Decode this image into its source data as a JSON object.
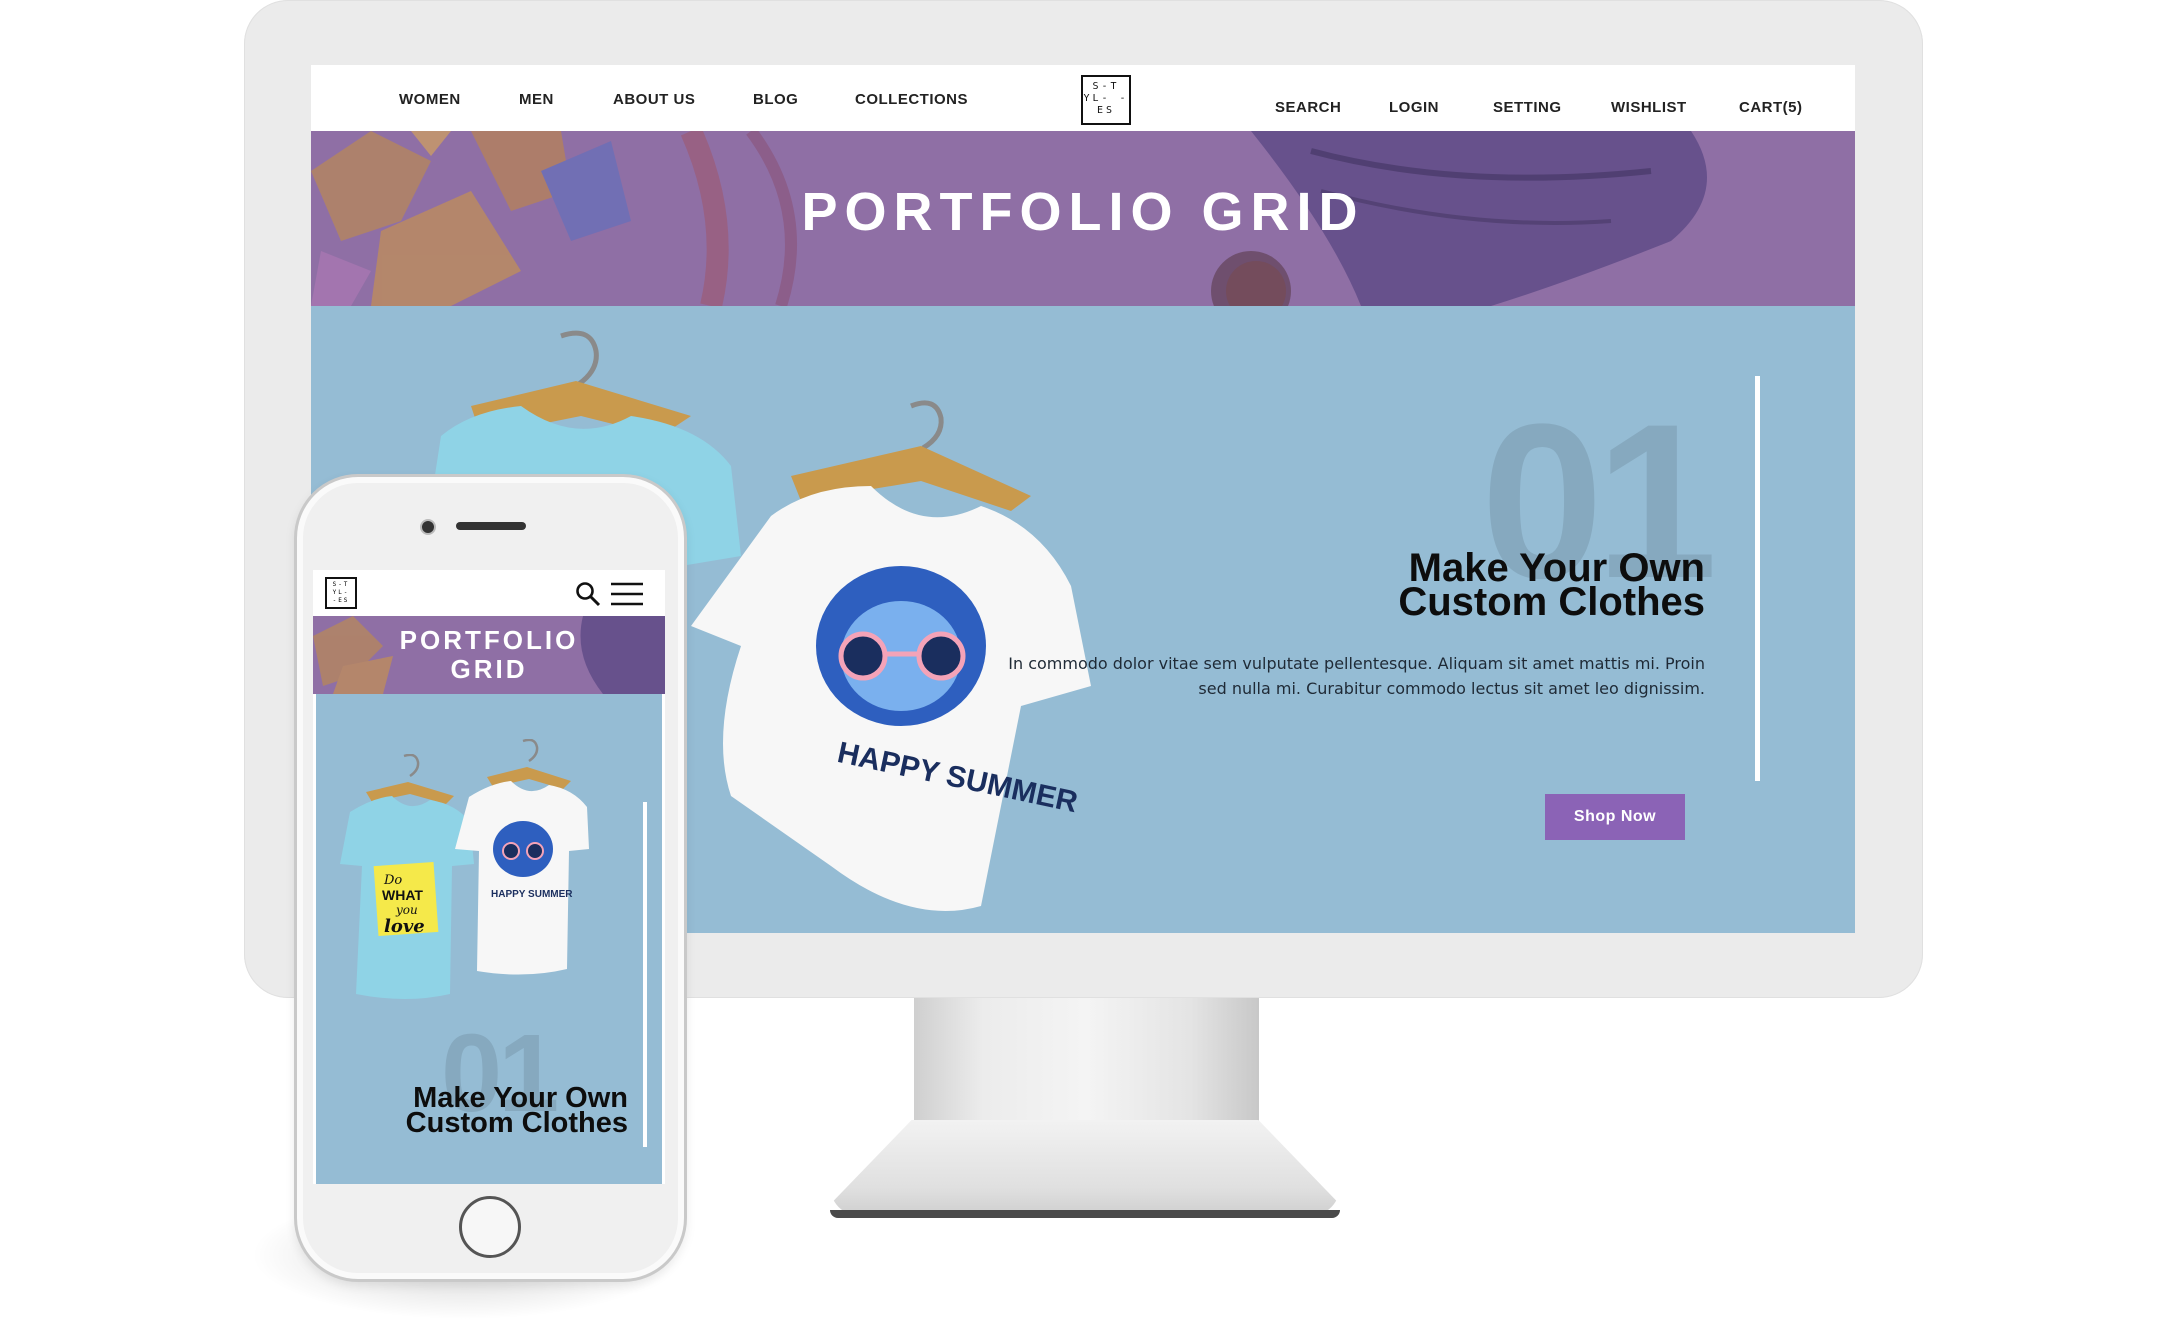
{
  "desktop": {
    "nav": {
      "left_items": [
        "WOMEN",
        "MEN",
        "ABOUT US",
        "BLOG",
        "COLLECTIONS"
      ],
      "logo_text": "S-T YL- -ES",
      "right_items": [
        "SEARCH",
        "LOGIN",
        "SETTING",
        "WISHLIST",
        "CART(5)"
      ]
    },
    "banner": {
      "title": "PORTFOLIO GRID"
    },
    "hero": {
      "number": "01",
      "heading_line1": "Make Your Own",
      "heading_line2": "Custom Clothes",
      "text": "In commodo dolor vitae sem vulputate pellentesque. Aliquam sit amet mattis mi. Proin sed nulla mi. Curabitur commodo lectus sit amet leo dignissim.",
      "button_label": "Shop Now",
      "shirt_white_print": "HAPPY SUMMER"
    }
  },
  "phone": {
    "banner": {
      "title_line1": "PORTFOLIO",
      "title_line2": "GRID"
    },
    "hero": {
      "number": "01",
      "heading_line1": "Make Your Own",
      "heading_line2": "Custom Clothes",
      "shirt_blue_print": [
        "Do",
        "WHAT",
        "you",
        "love"
      ],
      "shirt_white_print": "HAPPY SUMMER"
    }
  },
  "colors": {
    "banner_purple": "#8f6fa5",
    "hero_blue": "#95bcd4",
    "button_purple": "#8b63b6",
    "shirt_blue": "#8fd3e6"
  }
}
